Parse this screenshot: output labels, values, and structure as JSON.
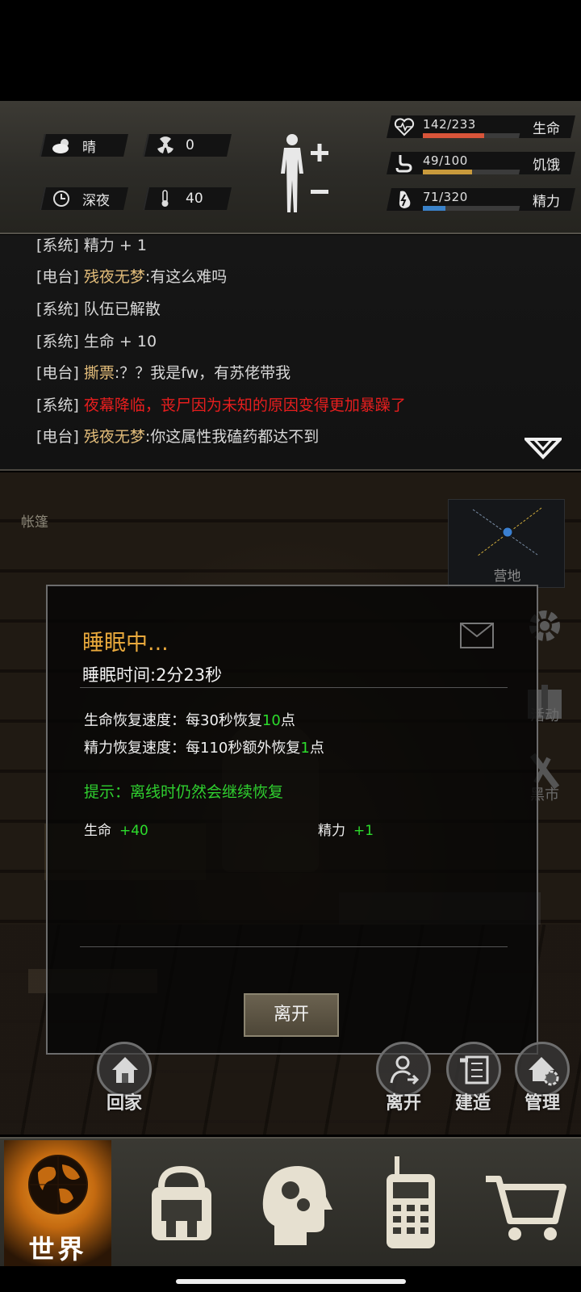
{
  "hud": {
    "weather": "晴",
    "radiation": "0",
    "time_of_day": "深夜",
    "temperature": "40",
    "stats": [
      {
        "icon": "heart-rate-icon",
        "value": "142/233",
        "label": "生命",
        "fraction": 0.609,
        "color": "#d9553a"
      },
      {
        "icon": "stomach-icon",
        "value": "49/100",
        "label": "饥饿",
        "fraction": 0.49,
        "color": "#c99a3c"
      },
      {
        "icon": "energy-icon",
        "value": "71/320",
        "label": "精力",
        "fraction": 0.222,
        "color": "#3a82c9"
      }
    ]
  },
  "log": {
    "partial_line": "[系统] 精力 + 1",
    "lines": [
      {
        "tag": "[电台]",
        "name": "残夜无梦",
        "text": ":有这么难吗",
        "style": "normal"
      },
      {
        "tag": "[系统]",
        "name": "",
        "text": "队伍已解散",
        "style": "normal"
      },
      {
        "tag": "[系统]",
        "name": "",
        "text": "生命 + 10",
        "style": "normal"
      },
      {
        "tag": "[电台]",
        "name": "撕票",
        "text": ":？？我是fw，有苏佬带我",
        "style": "normal"
      },
      {
        "tag": "[系统]",
        "name": "",
        "text": "夜幕降临，丧尸因为未知的原因变得更加暴躁了",
        "style": "red"
      },
      {
        "tag": "[电台]",
        "name": "残夜无梦",
        "text": ":你这属性我磕药都达不到",
        "style": "normal"
      }
    ]
  },
  "scene": {
    "location": "帐篷",
    "camp_label": "营地",
    "side": {
      "activity": "活动",
      "market": "黑市"
    }
  },
  "dialog": {
    "title": "睡眠中...",
    "time": "睡眠时间:2分23秒",
    "hp_regen_prefix": "生命恢复速度：每30秒恢复",
    "hp_regen_value": "10",
    "hp_regen_suffix": "点",
    "energy_regen_prefix": "精力恢复速度：每110秒额外恢复",
    "energy_regen_value": "1",
    "energy_regen_suffix": "点",
    "tip": "提示：离线时仍然会继续恢复",
    "stat_hp_label": "生命",
    "stat_hp_value": "+40",
    "stat_energy_label": "精力",
    "stat_energy_value": "+1",
    "leave_button": "离开"
  },
  "actions": {
    "home": "回家",
    "leave": "离开",
    "build": "建造",
    "manage": "管理"
  },
  "nav": {
    "world": "世界"
  }
}
